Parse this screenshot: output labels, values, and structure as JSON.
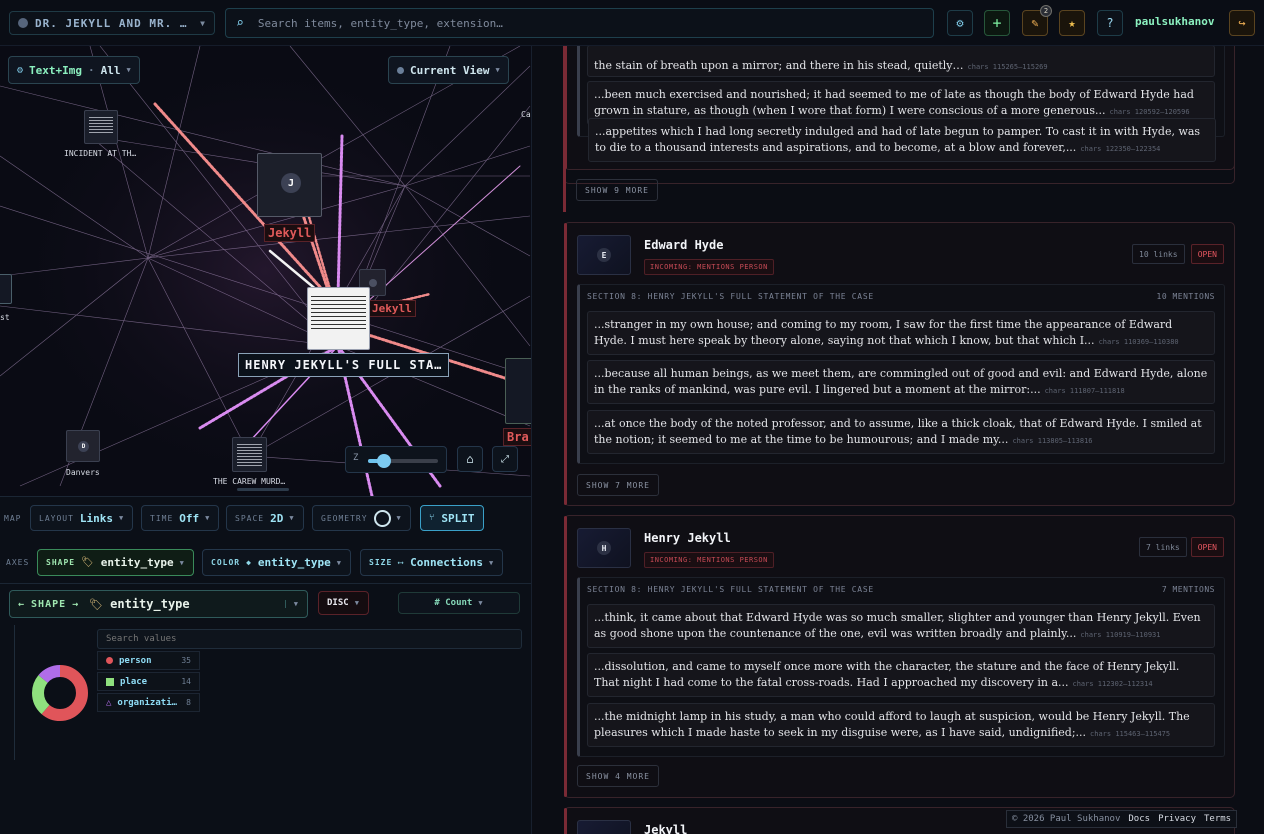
{
  "header": {
    "project": "DR. JEKYLL AND MR. …",
    "search_placeholder": "Search items, entity_type, extension…",
    "notif_count": "2",
    "username": "paulsukhanov"
  },
  "graph": {
    "mode_label": "Text+Img",
    "mode_value": "All",
    "view_label": "Current View",
    "focus_label": "HENRY JEKYLL'S FULL STA…",
    "nodes": {
      "incident": "INCIDENT AT TH…",
      "carew": "THE CAREW MURD…",
      "danvers": "Danvers",
      "jekyll_upper": "Jekyll",
      "jekyll_lower": "Jekyll",
      "bra": "Bra",
      "ca": "Ca",
      "st": "st"
    },
    "node_letters": {
      "j": "J",
      "d": "D"
    },
    "zoom_letter": "Z"
  },
  "controls": {
    "map_label": "MAP",
    "layout": {
      "label": "LAYOUT",
      "value": "Links"
    },
    "time": {
      "label": "TIME",
      "value": "Off"
    },
    "space": {
      "label": "SPACE",
      "value": "2D"
    },
    "geometry": {
      "label": "GEOMETRY"
    },
    "split_label": "SPLIT",
    "axes_label": "AXES",
    "shape": {
      "label": "SHAPE",
      "value": "entity_type"
    },
    "color": {
      "label": "COLOR",
      "value": "entity_type"
    },
    "size": {
      "label": "SIZE",
      "value": "Connections"
    },
    "shape_selector": {
      "label": "SHAPE",
      "value": "entity_type"
    },
    "disc_label": "DISC",
    "count_label": "# Count",
    "search_values_placeholder": "Search values",
    "legend": [
      {
        "name": "person",
        "count": "35",
        "color": "#e0555a"
      },
      {
        "name": "place",
        "count": "14",
        "color": "#8fe07e"
      },
      {
        "name": "organizati…",
        "count": "8",
        "color": "#b06de8"
      }
    ]
  },
  "panel": {
    "cards": [
      {
        "snippets": [
          {
            "text": "the stain of breath upon a mirror; and there in his stead, quietly…",
            "chars": "chars 115265–115269"
          },
          {
            "text": "...been much exercised and nourished; it had seemed to me of late as though the body of Edward Hyde had grown in stature, as though (when I wore that form) I were conscious of a more generous...",
            "chars": "chars 120592–120596"
          },
          {
            "text": "...appetites which I had long secretly indulged and had of late begun to pamper. To cast it in with Hyde, was to die to a thousand interests and aspirations, and to become, at a blow and forever,...",
            "chars": "chars 122350–122354"
          }
        ],
        "show_more": "SHOW 9 MORE"
      },
      {
        "name": "Edward Hyde",
        "letter": "E",
        "tag": "INCOMING: MENTIONS PERSON",
        "links": "10 links",
        "open": "OPEN",
        "section_title": "SECTION 8: HENRY JEKYLL'S FULL STATEMENT OF THE CASE",
        "section_count": "10 MENTIONS",
        "snippets": [
          {
            "text": "...stranger in my own house; and coming to my room, I saw for the first time the appearance of Edward Hyde. I must here speak by theory alone, saying not that which I know, but that which I...",
            "chars": "chars 110369–110380"
          },
          {
            "text": "...because all human beings, as we meet them, are commingled out of good and evil: and Edward Hyde, alone in the ranks of mankind, was pure evil. I lingered but a moment at the mirror:...",
            "chars": "chars 111807–111818"
          },
          {
            "text": "...at once the body of the noted professor, and to assume, like a thick cloak, that of Edward Hyde. I smiled at the notion; it seemed to me at the time to be humourous; and I made my...",
            "chars": "chars 113805–113816"
          }
        ],
        "show_more": "SHOW 7 MORE"
      },
      {
        "name": "Henry Jekyll",
        "letter": "H",
        "tag": "INCOMING: MENTIONS PERSON",
        "links": "7 links",
        "open": "OPEN",
        "section_title": "SECTION 8: HENRY JEKYLL'S FULL STATEMENT OF THE CASE",
        "section_count": "7 MENTIONS",
        "snippets": [
          {
            "text": "...think, it came about that Edward Hyde was so much smaller, slighter and younger than Henry Jekyll. Even as good shone upon the countenance of the one, evil was written broadly and plainly...",
            "chars": "chars 110919–110931"
          },
          {
            "text": "...dissolution, and came to myself once more with the character, the stature and the face of Henry Jekyll. That night I had come to the fatal cross-roads. Had I approached my discovery in a...",
            "chars": "chars 112302–112314"
          },
          {
            "text": "...the midnight lamp in his study, a man who could afford to laugh at suspicion, would be Henry Jekyll. The pleasures which I made haste to seek in my disguise were, as I have said, undignified;...",
            "chars": "chars 115463–115475"
          }
        ],
        "show_more": "SHOW 4 MORE"
      },
      {
        "name": "Jekyll"
      }
    ]
  },
  "footer": {
    "copyright": "© 2026 Paul Sukhanov",
    "docs": "Docs",
    "privacy": "Privacy",
    "terms": "Terms"
  }
}
